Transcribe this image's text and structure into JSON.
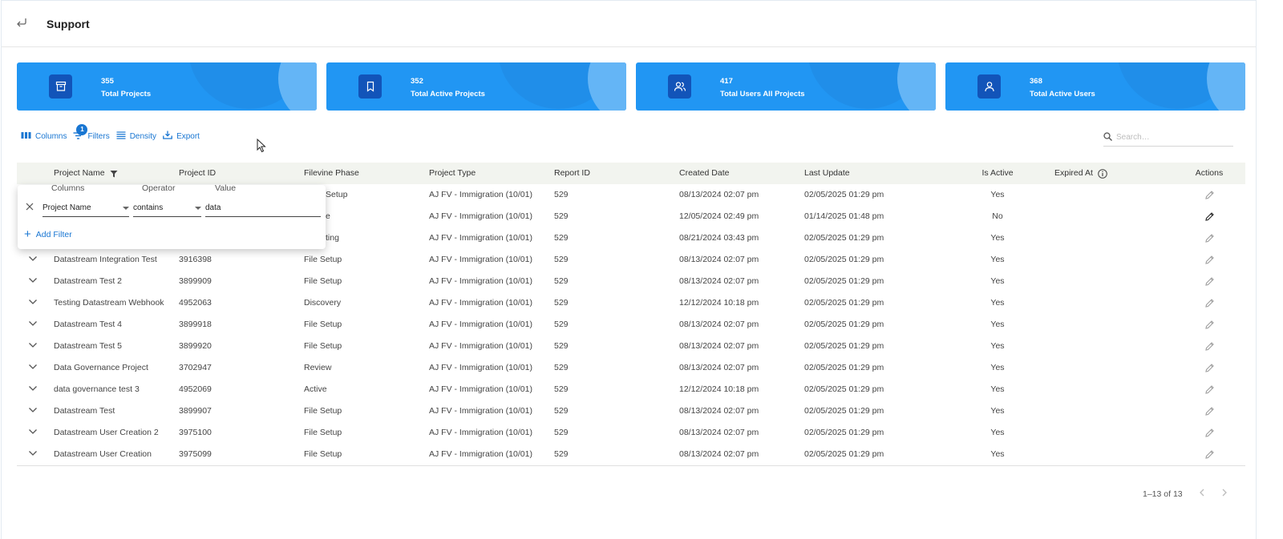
{
  "header": {
    "title": "Support"
  },
  "cards": [
    {
      "value": "355",
      "label": "Total Projects",
      "icon": "archive-icon"
    },
    {
      "value": "352",
      "label": "Total Active Projects",
      "icon": "bookmark-icon"
    },
    {
      "value": "417",
      "label": "Total Users All Projects",
      "icon": "users-icon"
    },
    {
      "value": "368",
      "label": "Total Active Users",
      "icon": "user-icon"
    }
  ],
  "toolbar": {
    "columns_label": "Columns",
    "filters_label": "Filters",
    "filters_count": "1",
    "density_label": "Density",
    "export_label": "Export",
    "search_placeholder": "Search…"
  },
  "table": {
    "columns": [
      "Project Name",
      "Project ID",
      "Filevine Phase",
      "Project Type",
      "Report ID",
      "Created Date",
      "Last Update",
      "Is Active",
      "Expired At",
      "Actions"
    ],
    "partial_rows": [
      {
        "phase": "Setup",
        "type": "AJ FV - Immigration (10/01)",
        "report_id": "529",
        "created": "08/13/2024 02:07 pm",
        "updated": "02/05/2025 01:29 pm",
        "active": "Yes"
      },
      {
        "phase": "e",
        "type": "AJ FV - Immigration (10/01)",
        "report_id": "529",
        "created": "12/05/2024 02:49 pm",
        "updated": "01/14/2025 01:48 pm",
        "active": "No"
      },
      {
        "phase": "ting",
        "type": "AJ FV - Immigration (10/01)",
        "report_id": "529",
        "created": "08/21/2024 03:43 pm",
        "updated": "02/05/2025 01:29 pm",
        "active": "Yes"
      }
    ],
    "rows": [
      {
        "name": "Datastream Integration Test",
        "id": "3916398",
        "phase": "File Setup",
        "type": "AJ FV - Immigration (10/01)",
        "report_id": "529",
        "created": "08/13/2024 02:07 pm",
        "updated": "02/05/2025 01:29 pm",
        "active": "Yes"
      },
      {
        "name": "Datastream Test 2",
        "id": "3899909",
        "phase": "File Setup",
        "type": "AJ FV - Immigration (10/01)",
        "report_id": "529",
        "created": "08/13/2024 02:07 pm",
        "updated": "02/05/2025 01:29 pm",
        "active": "Yes"
      },
      {
        "name": "Testing Datastream Webhook",
        "id": "4952063",
        "phase": "Discovery",
        "type": "AJ FV - Immigration (10/01)",
        "report_id": "529",
        "created": "12/12/2024 10:18 pm",
        "updated": "02/05/2025 01:29 pm",
        "active": "Yes"
      },
      {
        "name": "Datastream Test 4",
        "id": "3899918",
        "phase": "File Setup",
        "type": "AJ FV - Immigration (10/01)",
        "report_id": "529",
        "created": "08/13/2024 02:07 pm",
        "updated": "02/05/2025 01:29 pm",
        "active": "Yes"
      },
      {
        "name": "Datastream Test 5",
        "id": "3899920",
        "phase": "File Setup",
        "type": "AJ FV - Immigration (10/01)",
        "report_id": "529",
        "created": "08/13/2024 02:07 pm",
        "updated": "02/05/2025 01:29 pm",
        "active": "Yes"
      },
      {
        "name": "Data Governance Project",
        "id": "3702947",
        "phase": "Review",
        "type": "AJ FV - Immigration (10/01)",
        "report_id": "529",
        "created": "08/13/2024 02:07 pm",
        "updated": "02/05/2025 01:29 pm",
        "active": "Yes"
      },
      {
        "name": "data governance test 3",
        "id": "4952069",
        "phase": "Active",
        "type": "AJ FV - Immigration (10/01)",
        "report_id": "529",
        "created": "12/12/2024 10:18 pm",
        "updated": "02/05/2025 01:29 pm",
        "active": "Yes"
      },
      {
        "name": "Datastream Test",
        "id": "3899907",
        "phase": "File Setup",
        "type": "AJ FV - Immigration (10/01)",
        "report_id": "529",
        "created": "08/13/2024 02:07 pm",
        "updated": "02/05/2025 01:29 pm",
        "active": "Yes"
      },
      {
        "name": "Datastream User Creation 2",
        "id": "3975100",
        "phase": "File Setup",
        "type": "AJ FV - Immigration (10/01)",
        "report_id": "529",
        "created": "08/13/2024 02:07 pm",
        "updated": "02/05/2025 01:29 pm",
        "active": "Yes"
      },
      {
        "name": "Datastream User Creation",
        "id": "3975099",
        "phase": "File Setup",
        "type": "AJ FV - Immigration (10/01)",
        "report_id": "529",
        "created": "08/13/2024 02:07 pm",
        "updated": "02/05/2025 01:29 pm",
        "active": "Yes"
      }
    ]
  },
  "filter_panel": {
    "columns_label": "Columns",
    "operator_label": "Operator",
    "value_label": "Value",
    "column": "Project Name",
    "operator": "contains",
    "value": "data",
    "add_filter_label": "Add Filter"
  },
  "pagination": {
    "range": "1–13 of 13"
  },
  "colors": {
    "card_bg": "#2196f3",
    "card_icon_bg": "#1254b9",
    "accent": "#1976d2",
    "header_row_bg": "#f2f4ef"
  }
}
